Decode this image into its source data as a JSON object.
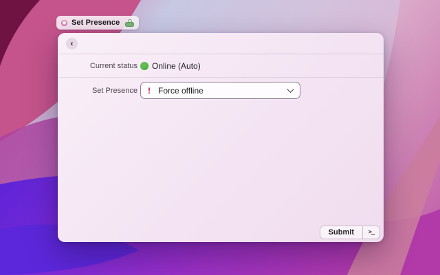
{
  "chip": {
    "title": "Set Presence"
  },
  "icons": {
    "back": "‹",
    "favicon": "flower-icon",
    "lock": "lock-icon",
    "chevron_down": "chevron-down-icon",
    "terminal": ">_"
  },
  "window": {
    "status_row": {
      "label": "Current status",
      "value": "Online (Auto)"
    },
    "presence_row": {
      "label": "Set Presence",
      "dropdown": {
        "warning_glyph": "!",
        "value": "Force offline"
      }
    },
    "footer": {
      "submit": "Submit",
      "terminal_glyph": ">_"
    }
  },
  "colors": {
    "status_online": "#3fa338",
    "warning_red": "#c41836",
    "lock_green": "#79b879",
    "window_bg_start": "#f9f0f8",
    "window_bg_end": "#f0ddef"
  }
}
